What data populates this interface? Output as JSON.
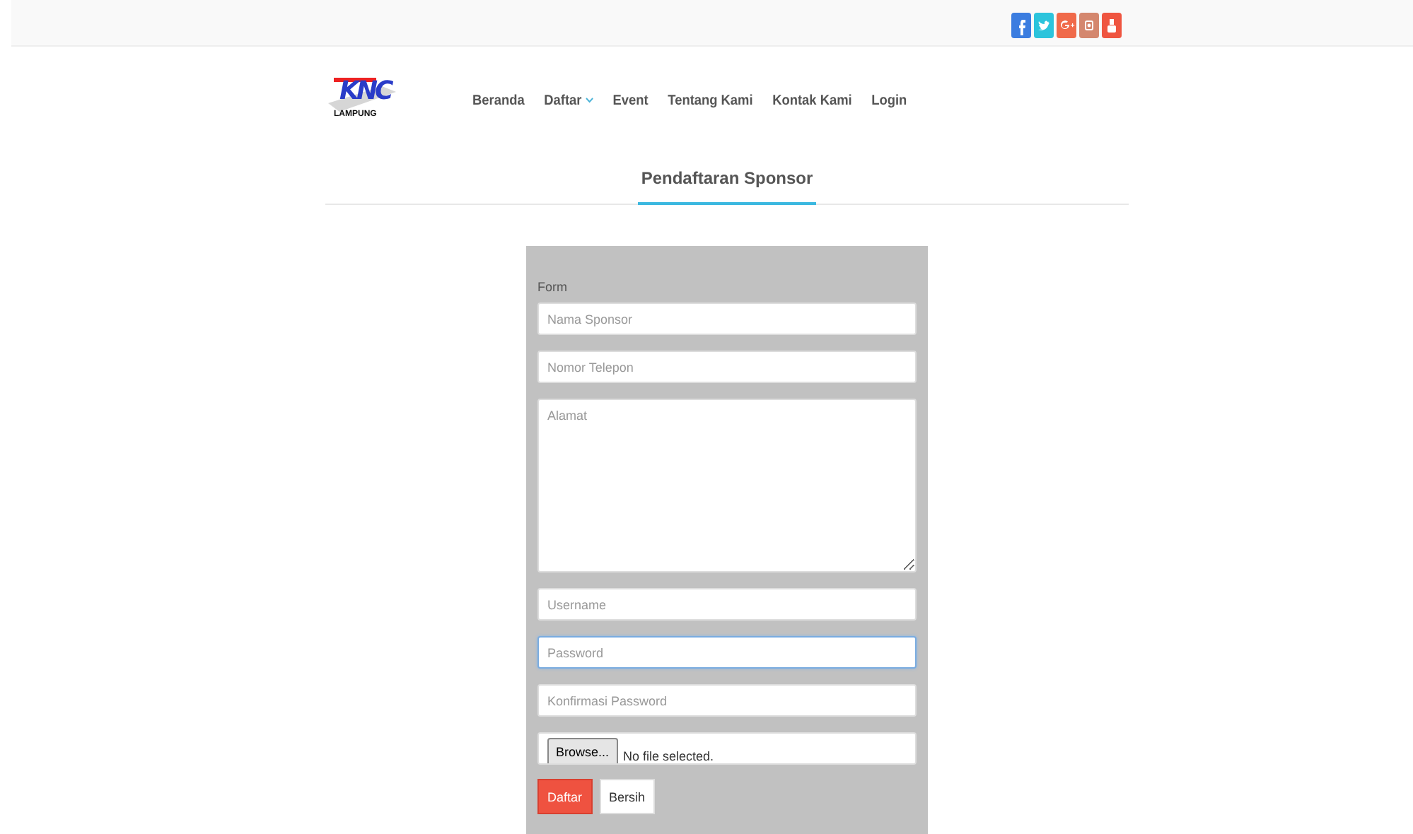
{
  "social_links": [
    {
      "kind": "facebook",
      "color": "#3b7de0"
    },
    {
      "kind": "twitter",
      "color": "#2cc4dc"
    },
    {
      "kind": "googleplus",
      "color": "#f06a4a"
    },
    {
      "kind": "instagram",
      "color": "#d4876e"
    },
    {
      "kind": "youtube",
      "color": "#ef5540"
    }
  ],
  "logo": {
    "top_text": "KNC",
    "bottom_text": "LAMPUNG"
  },
  "nav": [
    {
      "label": "Beranda",
      "dropdown": false
    },
    {
      "label": "Daftar",
      "dropdown": true
    },
    {
      "label": "Event",
      "dropdown": false
    },
    {
      "label": "Tentang Kami",
      "dropdown": false
    },
    {
      "label": "Kontak Kami",
      "dropdown": false
    },
    {
      "label": "Login",
      "dropdown": false
    }
  ],
  "page_title": "Pendaftaran Sponsor",
  "form": {
    "legend": "Form",
    "fields": [
      {
        "kind": "text",
        "placeholder": "Nama Sponsor",
        "focused": false
      },
      {
        "kind": "number",
        "placeholder": "Nomor Telepon",
        "focused": false
      },
      {
        "kind": "textarea",
        "placeholder": "Alamat",
        "focused": false
      },
      {
        "kind": "text",
        "placeholder": "Username",
        "focused": false
      },
      {
        "kind": "password",
        "placeholder": "Password",
        "focused": true
      },
      {
        "kind": "password",
        "placeholder": "Konfirmasi Password",
        "focused": false
      },
      {
        "kind": "file",
        "button": "Browse...",
        "status": "No file selected."
      }
    ],
    "buttons": [
      {
        "label": "Daftar",
        "primary": true
      },
      {
        "label": "Bersih",
        "primary": false
      }
    ]
  }
}
